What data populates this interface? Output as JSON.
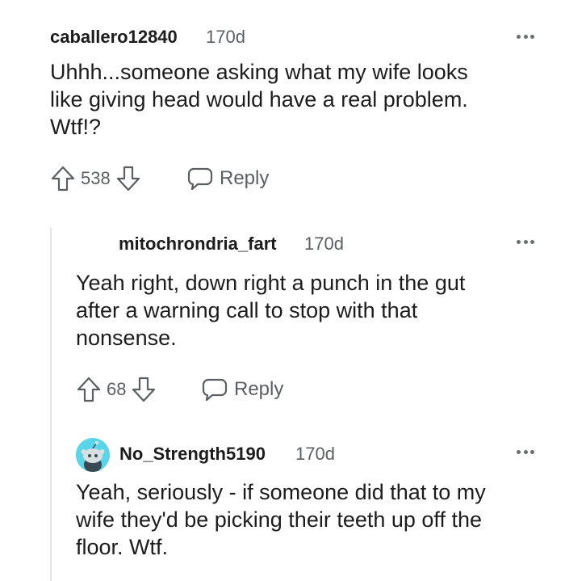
{
  "comments": [
    {
      "username": "caballero12840",
      "timestamp": "170d",
      "body": [
        "Uhhh...someone asking what my wife looks",
        "like giving head would have a real problem.",
        "Wtf!?"
      ],
      "votes": "538",
      "reply_label": "Reply"
    },
    {
      "username": "mitochrondria_fart",
      "timestamp": "170d",
      "body": [
        "Yeah right, down right a punch in the gut",
        "after a warning call to stop with that",
        "nonsense."
      ],
      "votes": "68",
      "reply_label": "Reply"
    },
    {
      "username": "No_Strength5190",
      "timestamp": "170d",
      "body": [
        "Yeah, seriously - if someone did that to my",
        "wife they'd be picking their teeth up off the",
        "floor. Wtf."
      ]
    }
  ],
  "icons": {
    "upvote": "upvote-arrow-icon",
    "downvote": "downvote-arrow-icon",
    "reply": "speech-bubble-icon",
    "more": "more-options-icon",
    "avatar": "snoo-avatar-icon"
  },
  "colors": {
    "text": "#1c1c1c",
    "meta": "#5b5f62",
    "avatar_bg": "#59d5ea",
    "thread_line": "#e3e5e7"
  }
}
